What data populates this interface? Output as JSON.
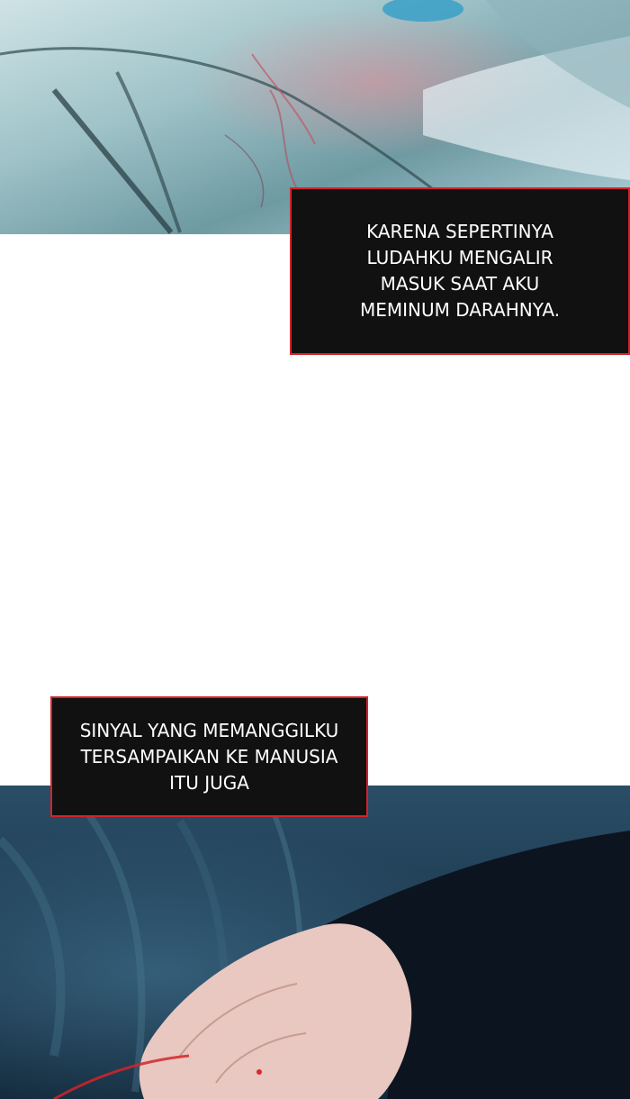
{
  "captions": [
    {
      "lines": [
        "KARENA SEPERTINYA",
        "LUDAHKU MENGALIR",
        "MASUK SAAT AKU",
        "MEMINUM DARAHNYA."
      ]
    },
    {
      "lines": [
        "SINYAL YANG MEMANGGILKU",
        "TERSAMPAIKAN KE MANUSIA",
        "ITU JUGA"
      ]
    }
  ],
  "colors": {
    "caption_background": "#111111",
    "caption_border": "#d3232a",
    "caption_text": "#ffffff",
    "page_background": "#ffffff"
  }
}
